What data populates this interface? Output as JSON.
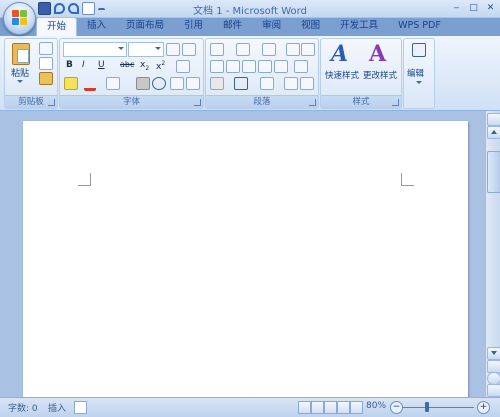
{
  "app": {
    "title": "文档 1 - Microsoft Word"
  },
  "tabs": [
    "开始",
    "插入",
    "页面布局",
    "引用",
    "邮件",
    "审阅",
    "视图",
    "开发工具",
    "WPS PDF"
  ],
  "ribbon": {
    "clipboard": {
      "label": "剪贴板",
      "paste": "粘贴"
    },
    "font": {
      "label": "字体"
    },
    "paragraph": {
      "label": "段落"
    },
    "styles": {
      "label": "样式",
      "quick_styles": "快速样式",
      "change_styles": "更改样式"
    },
    "editing": {
      "label": "编辑"
    }
  },
  "status": {
    "word_count": "字数: 0",
    "insert_mode": "插入",
    "zoom": "80%"
  },
  "colors": {
    "accent": "#15428b",
    "ribbon": "#dde9f8",
    "document_bg": "#a9c1e3"
  }
}
